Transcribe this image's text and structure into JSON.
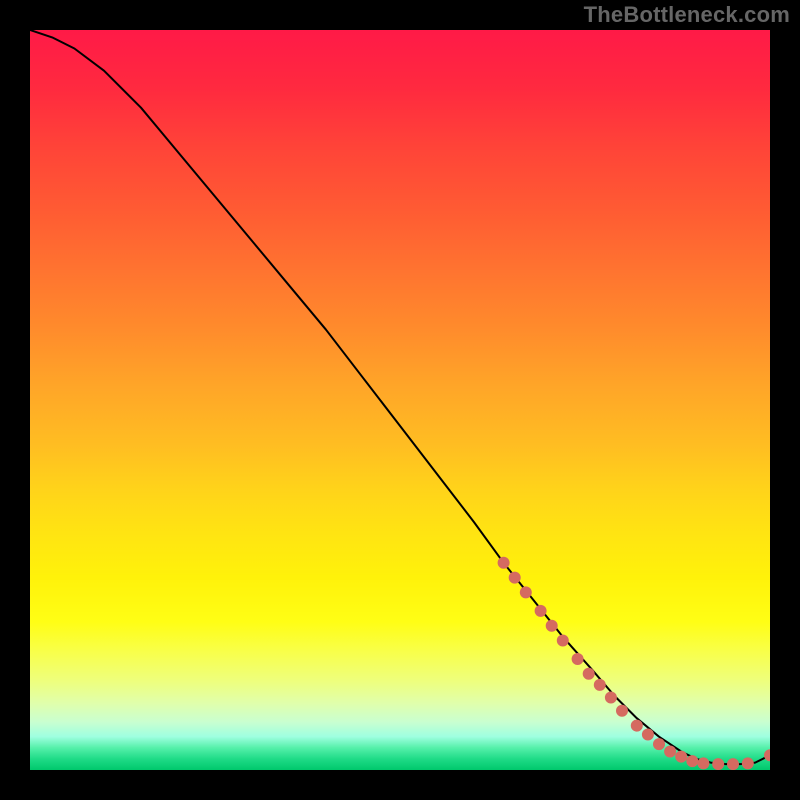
{
  "watermark": {
    "text": "TheBottleneck.com"
  },
  "chart_data": {
    "type": "line",
    "title": "",
    "xlabel": "",
    "ylabel": "",
    "xlim": [
      0,
      100
    ],
    "ylim": [
      0,
      100
    ],
    "grid": false,
    "legend": false,
    "series": [
      {
        "name": "curve",
        "x": [
          0,
          3,
          6,
          10,
          15,
          20,
          25,
          30,
          35,
          40,
          45,
          50,
          55,
          60,
          64,
          68,
          72,
          76,
          79,
          82,
          85,
          88,
          90,
          92,
          94,
          96,
          98,
          100
        ],
        "y": [
          100,
          99,
          97.5,
          94.5,
          89.5,
          83.5,
          77.5,
          71.5,
          65.5,
          59.5,
          53,
          46.5,
          40,
          33.5,
          28,
          23,
          18,
          13.5,
          10,
          7,
          4.5,
          2.5,
          1.5,
          1,
          0.8,
          0.8,
          1,
          2
        ],
        "color": "#000000"
      }
    ],
    "markers": [
      {
        "x": 64.0,
        "y": 28.0
      },
      {
        "x": 65.5,
        "y": 26.0
      },
      {
        "x": 67.0,
        "y": 24.0
      },
      {
        "x": 69.0,
        "y": 21.5
      },
      {
        "x": 70.5,
        "y": 19.5
      },
      {
        "x": 72.0,
        "y": 17.5
      },
      {
        "x": 74.0,
        "y": 15.0
      },
      {
        "x": 75.5,
        "y": 13.0
      },
      {
        "x": 77.0,
        "y": 11.5
      },
      {
        "x": 78.5,
        "y": 9.8
      },
      {
        "x": 80.0,
        "y": 8.0
      },
      {
        "x": 82.0,
        "y": 6.0
      },
      {
        "x": 83.5,
        "y": 4.8
      },
      {
        "x": 85.0,
        "y": 3.5
      },
      {
        "x": 86.5,
        "y": 2.5
      },
      {
        "x": 88.0,
        "y": 1.8
      },
      {
        "x": 89.5,
        "y": 1.2
      },
      {
        "x": 91.0,
        "y": 0.9
      },
      {
        "x": 93.0,
        "y": 0.8
      },
      {
        "x": 95.0,
        "y": 0.8
      },
      {
        "x": 97.0,
        "y": 0.9
      },
      {
        "x": 100.0,
        "y": 2.0
      }
    ],
    "marker_color": "#d56a60"
  }
}
